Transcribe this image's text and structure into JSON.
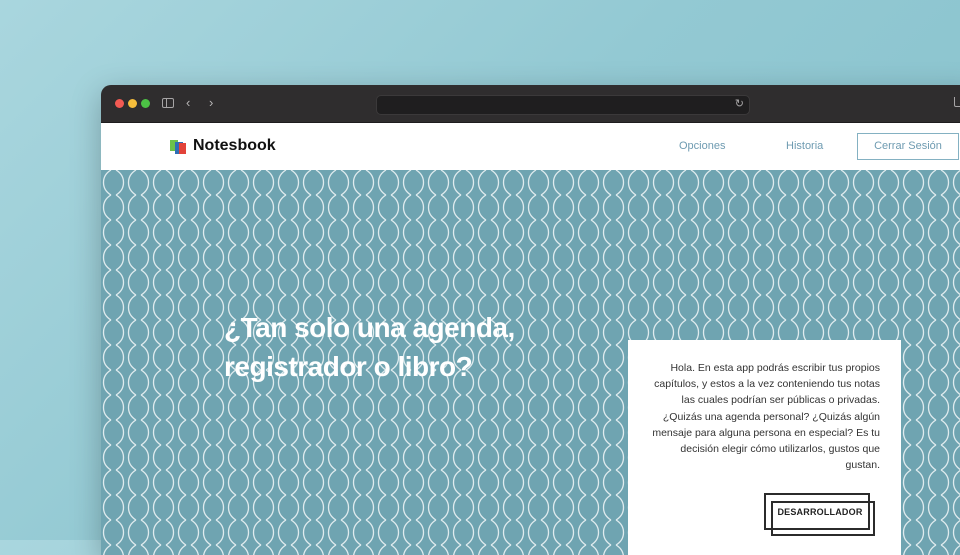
{
  "header": {
    "brand": "Notesbook",
    "nav": [
      "Opciones",
      "Historia"
    ],
    "logout_label": "Cerrar Sesión"
  },
  "hero": {
    "headline": "¿Tan solo una agenda, registrador o libro?"
  },
  "card": {
    "text": "Hola. En esta app podrás escribir tus propios capítulos, y estos a la vez conteniendo tus notas las cuales podrían ser públicas o privadas. ¿Quizás una agenda personal? ¿Quizás algún mensaje para alguna persona en especial? Es tu decisión elegir cómo utilizarlos, gustos que gustan.",
    "button_label": "DESARROLLADOR"
  },
  "icons": {
    "window_controls": [
      "close-icon",
      "minimize-icon",
      "maximize-icon"
    ],
    "toolbar": [
      "sidebar-icon",
      "back-icon",
      "forward-icon",
      "reload-icon",
      "share-icon"
    ],
    "logo": "notebook-logo-icon"
  },
  "colors": {
    "hero_background": "#6fa4b1",
    "nav_link": "#6e9bb1",
    "card_background": "#ffffff",
    "close": "#f25a53",
    "minimize": "#f5bd3b",
    "maximize": "#4cc245"
  }
}
